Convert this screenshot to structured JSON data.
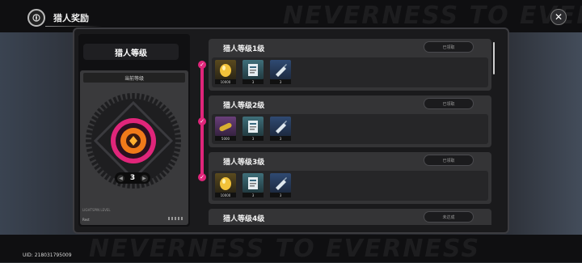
{
  "header": {
    "title": "猎人奖励",
    "logo_icon": "compass-icon",
    "close_icon": "close-icon"
  },
  "watermark_text": "NEVERNESS TO EVERNESS",
  "left_panel": {
    "heading": "猎人等级",
    "current_label": "当前等级",
    "level": "3",
    "small_text": "LIGHTSPIN LEVEL",
    "small_text2": "Rest"
  },
  "rows": [
    {
      "title": "猎人等级1级",
      "status": "已领取",
      "items": [
        {
          "icon": "gold-egg-icon",
          "count": "10000",
          "color": "gold"
        },
        {
          "icon": "document-icon",
          "count": "3",
          "color": "teal"
        },
        {
          "icon": "syringe-icon",
          "count": "3",
          "color": "blue"
        }
      ]
    },
    {
      "title": "猎人等级2级",
      "status": "已领取",
      "items": [
        {
          "icon": "capsule-icon",
          "count": "5000",
          "color": "purple"
        },
        {
          "icon": "document-icon",
          "count": "3",
          "color": "teal"
        },
        {
          "icon": "syringe-icon",
          "count": "3",
          "color": "blue"
        }
      ]
    },
    {
      "title": "猎人等级3级",
      "status": "已领取",
      "items": [
        {
          "icon": "gold-egg-icon",
          "count": "10000",
          "color": "gold"
        },
        {
          "icon": "document-icon",
          "count": "3",
          "color": "teal"
        },
        {
          "icon": "syringe-icon",
          "count": "3",
          "color": "blue"
        }
      ]
    },
    {
      "title": "猎人等级4级",
      "status": "未达成",
      "items": []
    }
  ],
  "footer": {
    "uid": "UID: 218031795009"
  },
  "colors": {
    "accent": "#e0257a",
    "panel": "#1a1a1c",
    "row": "#343436"
  }
}
